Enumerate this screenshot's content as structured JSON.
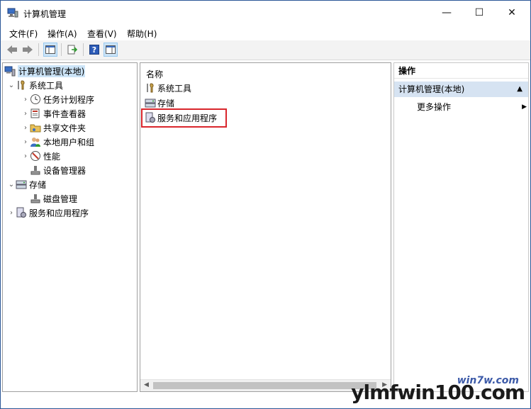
{
  "window": {
    "title": "计算机管理"
  },
  "controls": {
    "minimize": "—",
    "maximize": "☐",
    "close": "✕"
  },
  "menu": [
    "文件(F)",
    "操作(A)",
    "查看(V)",
    "帮助(H)"
  ],
  "tree": {
    "root": "计算机管理(本地)",
    "system_tools": "系统工具",
    "task_scheduler": "任务计划程序",
    "event_viewer": "事件查看器",
    "shared_folders": "共享文件夹",
    "local_users": "本地用户和组",
    "performance": "性能",
    "device_manager": "设备管理器",
    "storage": "存储",
    "disk_management": "磁盘管理",
    "services_apps": "服务和应用程序"
  },
  "list": {
    "column": "名称",
    "items": [
      "系统工具",
      "存储",
      "服务和应用程序"
    ]
  },
  "actions": {
    "header": "操作",
    "section": "计算机管理(本地)",
    "more": "更多操作"
  },
  "watermark": {
    "main": "ylmfwin100.com",
    "sub": "win7w.com"
  },
  "colors": {
    "selection": "#cce4f7",
    "highlight_box": "#d9262c",
    "action_section": "#d6e3f2"
  }
}
